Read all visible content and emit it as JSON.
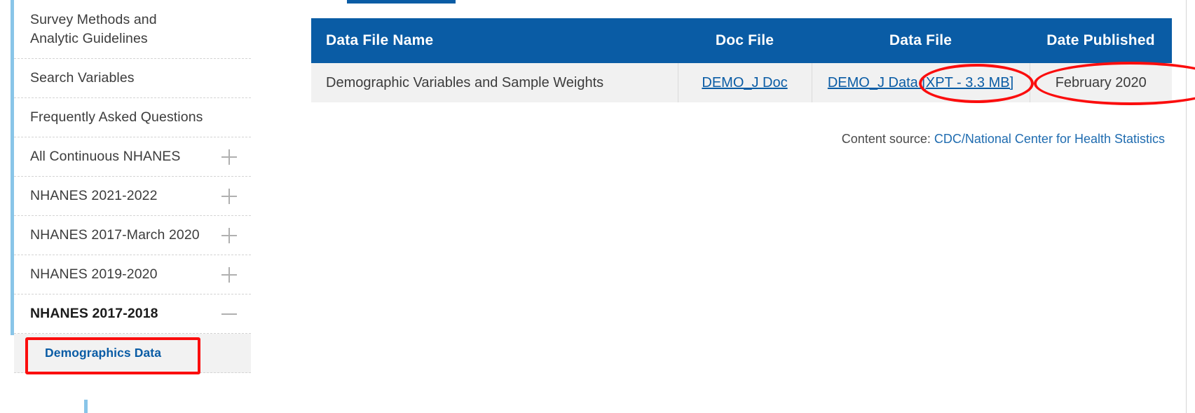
{
  "sidebar": {
    "items": [
      {
        "label": "Survey Methods and Analytic Guidelines",
        "icon": "",
        "expandable": false,
        "expanded": false,
        "two_line": true
      },
      {
        "label": "Search Variables",
        "icon": "",
        "expandable": false,
        "expanded": false,
        "two_line": false
      },
      {
        "label": "Frequently Asked Questions",
        "icon": "",
        "expandable": false,
        "expanded": false,
        "two_line": false
      },
      {
        "label": "All Continuous NHANES",
        "icon": "plus-icon",
        "expandable": true,
        "expanded": false,
        "two_line": false
      },
      {
        "label": "NHANES 2021-2022",
        "icon": "plus-icon",
        "expandable": true,
        "expanded": false,
        "two_line": false
      },
      {
        "label": "NHANES 2017-March 2020",
        "icon": "plus-icon",
        "expandable": true,
        "expanded": false,
        "two_line": false
      },
      {
        "label": "NHANES 2019-2020",
        "icon": "plus-icon",
        "expandable": true,
        "expanded": false,
        "two_line": false
      },
      {
        "label": "NHANES 2017-2018",
        "icon": "minus-icon",
        "expandable": true,
        "expanded": true,
        "two_line": false
      }
    ],
    "subitem": {
      "label": "Demographics Data",
      "selected": true
    }
  },
  "main": {
    "table": {
      "columns": [
        "Data File Name",
        "Doc File",
        "Data File",
        "Date Published"
      ],
      "rows": [
        {
          "name": "Demographic Variables and Sample Weights",
          "doc_file": "DEMO_J Doc",
          "data_file": "DEMO_J Data [XPT - 3.3 MB]",
          "date_published": "February 2020"
        }
      ]
    },
    "content_source": {
      "prefix": "Content source: ",
      "link": "CDC/National Center for Health Statistics"
    }
  },
  "annotations": {
    "color": "#fb0d0d",
    "shapes": [
      "ellipse-doc-file-link",
      "ellipse-data-file-link",
      "rect-demographics-data-sidebar"
    ]
  },
  "colors": {
    "header_blue": "#0a5ca5",
    "row_gray": "#f1f1f1",
    "accent_light_blue": "#89c5e8",
    "link_blue": "#0a5ca5",
    "annotation_red": "#fb0d0d"
  }
}
